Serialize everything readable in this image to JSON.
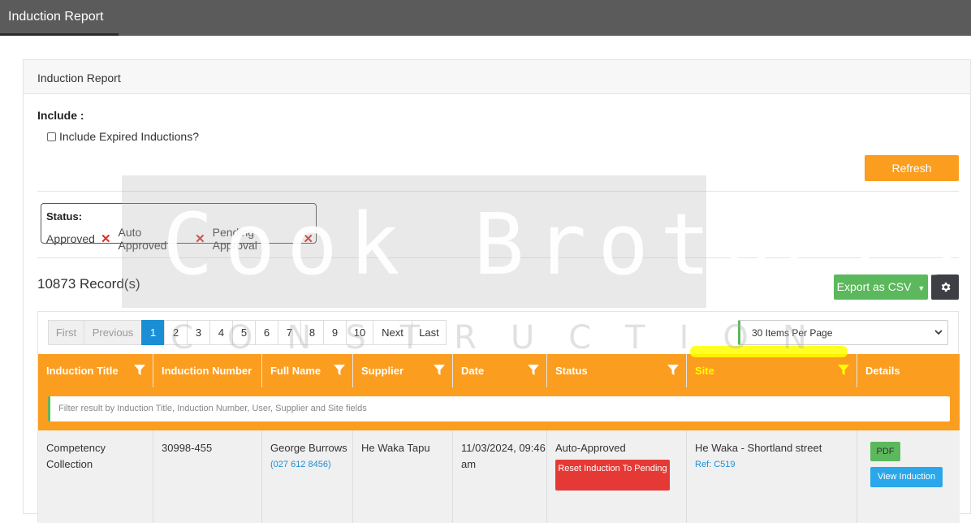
{
  "topbar": {
    "tab_label": "Induction Report"
  },
  "panel": {
    "heading": "Induction Report"
  },
  "include": {
    "label": "Include :",
    "checkbox_label": "Include Expired Inductions?"
  },
  "refresh_label": "Refresh",
  "status_filter": {
    "title": "Status:",
    "items": [
      "Approved",
      "Auto Approved",
      "Pending Approval"
    ],
    "remove_glyph": "✕"
  },
  "records_label": "10873 Record(s)",
  "export_label": "Export as CSV",
  "pagination": {
    "first": "First",
    "previous": "Previous",
    "pages": [
      "1",
      "2",
      "3",
      "4",
      "5",
      "6",
      "7",
      "8",
      "9",
      "10"
    ],
    "next": "Next",
    "last": "Last",
    "active": "1"
  },
  "per_page": "30 Items Per Page",
  "columns": [
    "Induction Title",
    "Induction Number",
    "Full Name",
    "Supplier",
    "Date",
    "Status",
    "Site",
    "Details"
  ],
  "filter_placeholder": "Filter result by Induction Title, Induction Number, User, Supplier and Site fields",
  "rows": [
    {
      "title": "Competency Collection",
      "number": "30998-455",
      "name": "George Burrows",
      "phone": "(027 612 8456)",
      "supplier": "He Waka Tapu",
      "date": "11/03/2024, 09:46 am",
      "status": "Auto-Approved",
      "reset_label": "Reset Induction To Pending",
      "site": "He Waka - Shortland street",
      "site_ref": "Ref: C519",
      "pdf_label": "PDF",
      "view_label": "View Induction"
    }
  ],
  "watermark": {
    "main": "Cook Brothers",
    "sub": "CONSTRUCTION"
  },
  "colors": {
    "orange": "#fb9d1f",
    "green": "#5cb85c",
    "blue": "#1b8fd6",
    "red": "#e53935",
    "highlight": "#ffff00"
  },
  "icons": {
    "filter": "funnel-icon",
    "settings": "gear-icon",
    "dropdown": "caret-down-icon"
  }
}
